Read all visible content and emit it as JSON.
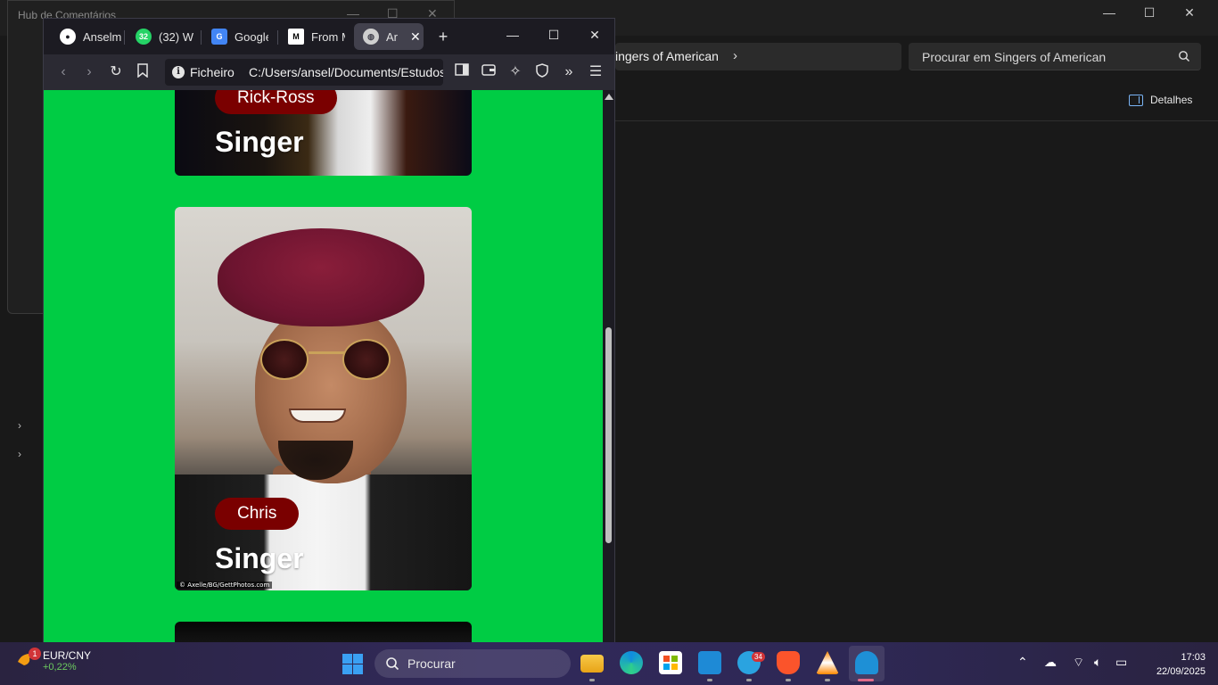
{
  "explorer": {
    "address_crumb": "ingers of American",
    "search_placeholder": "Procurar em Singers of American",
    "details_label": "Detalhes"
  },
  "hub_window": {
    "title": "Hub de Comentários"
  },
  "browser": {
    "tabs": [
      {
        "label": "Anselm",
        "icon": "github-icon"
      },
      {
        "label": "(32) W",
        "icon": "whatsapp-icon",
        "badge": "32"
      },
      {
        "label": "Google",
        "icon": "google-translate-icon"
      },
      {
        "label": "From M",
        "icon": "medium-icon"
      },
      {
        "label": "Ar",
        "icon": "globe-icon",
        "active": true
      }
    ],
    "url_label": "Ficheiro",
    "url_path": "C:/Users/ansel/Documents/Estudos"
  },
  "page": {
    "cards": [
      {
        "name": "Rick-Ross",
        "role": "Singer"
      },
      {
        "name": "Chris",
        "role": "Singer",
        "credit": "© Axelle/BG/GettPhotos.com"
      }
    ]
  },
  "taskbar": {
    "widget_title": "EUR/CNY",
    "widget_sub": "+0,22%",
    "widget_badge": "1",
    "search_placeholder": "Procurar",
    "telegram_badge": "34",
    "time": "17:03",
    "date": "22/09/2025"
  },
  "colors": {
    "page_background": "#00cc44",
    "pill_background": "#7a0000",
    "accent": "#3aa0f3"
  }
}
